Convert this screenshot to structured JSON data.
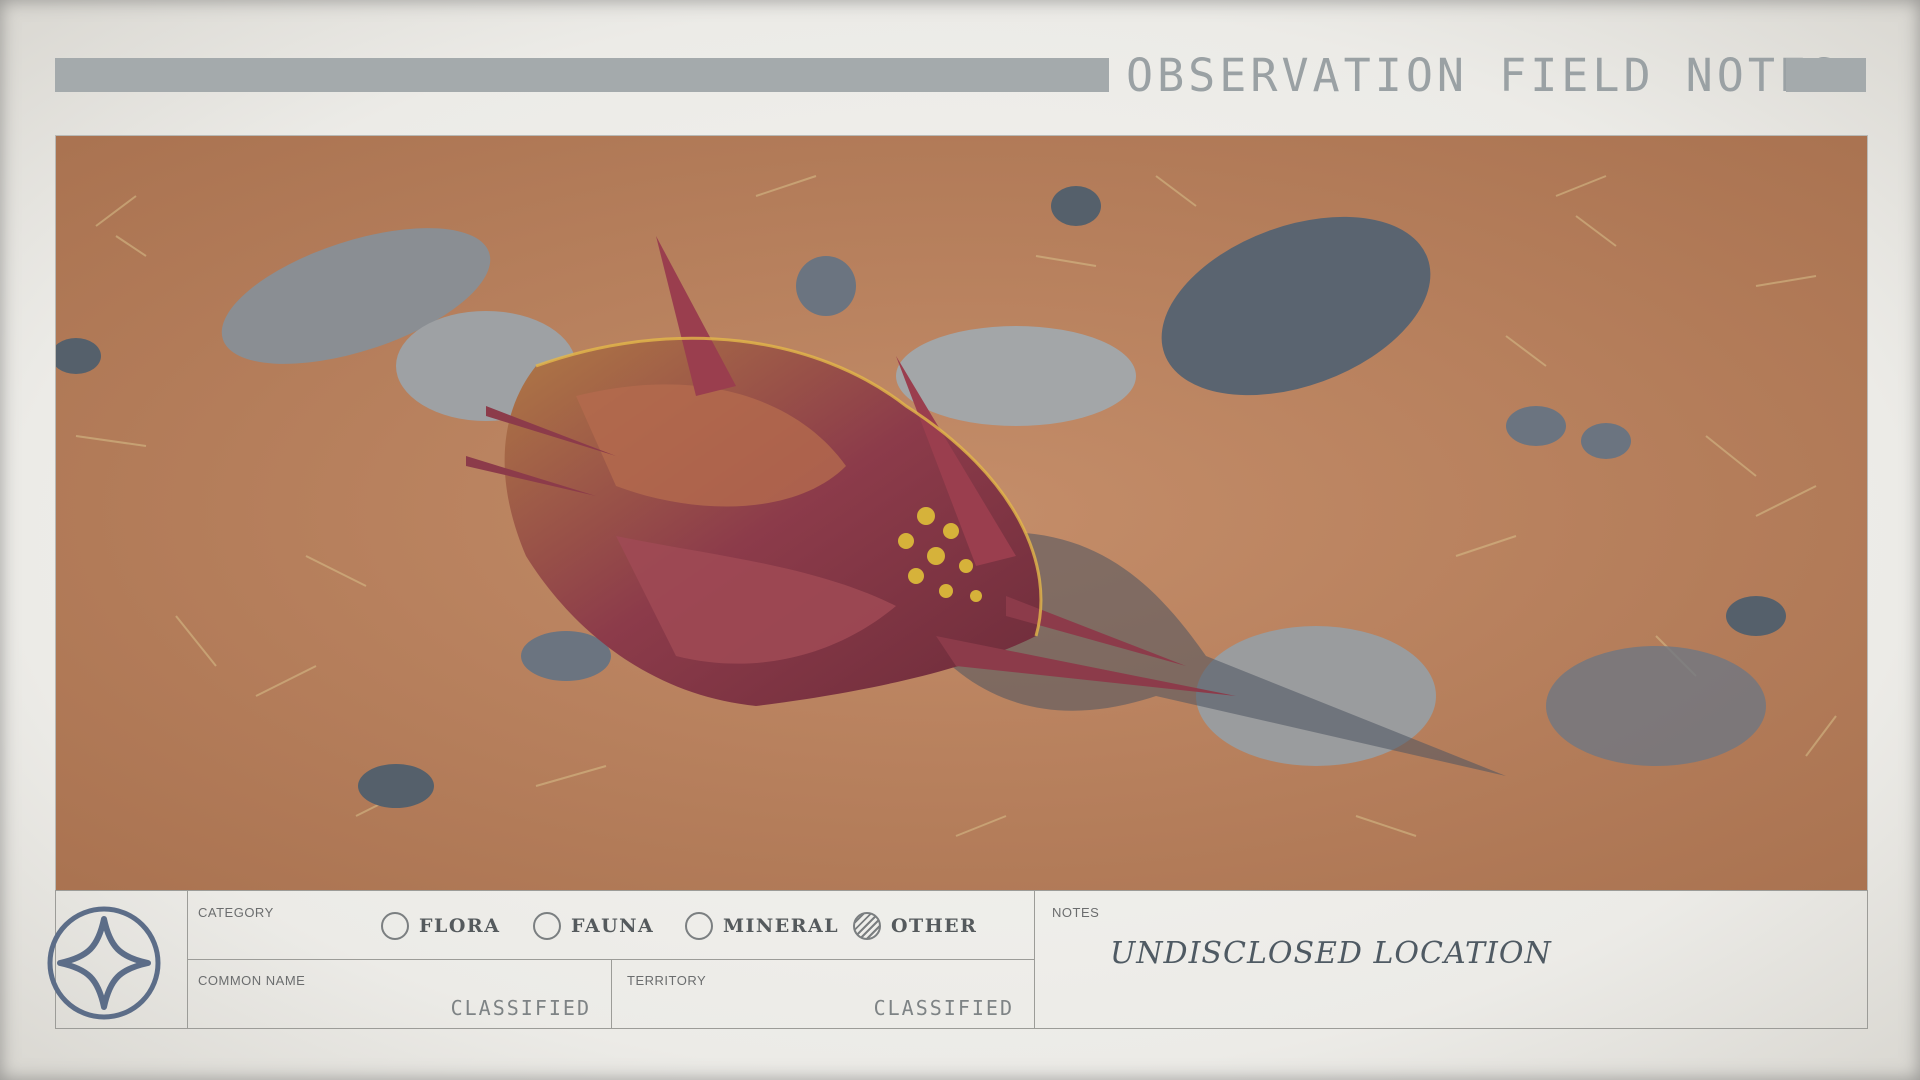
{
  "header": {
    "title": "OBSERVATION FIELD NOTES"
  },
  "form": {
    "category_label": "CATEGORY",
    "options": [
      {
        "label": "FLORA",
        "selected": false
      },
      {
        "label": "FAUNA",
        "selected": false
      },
      {
        "label": "MINERAL",
        "selected": false
      },
      {
        "label": "OTHER",
        "selected": true
      }
    ],
    "common_name_label": "COMMON NAME",
    "common_name_value": "CLASSIFIED",
    "territory_label": "TERRITORY",
    "territory_value": "CLASSIFIED",
    "notes_label": "NOTES",
    "notes_value": "UNDISCLOSED LOCATION"
  },
  "photo": {
    "subject": "armored-creature-carcass",
    "ground_color": "#b9825f",
    "rock_color": "#8a8e93",
    "creature_color": "#8c3b4a",
    "accent_color": "#d6b23a"
  },
  "logo": {
    "icon": "four-point-star-emblem",
    "color": "#5c6d88"
  }
}
